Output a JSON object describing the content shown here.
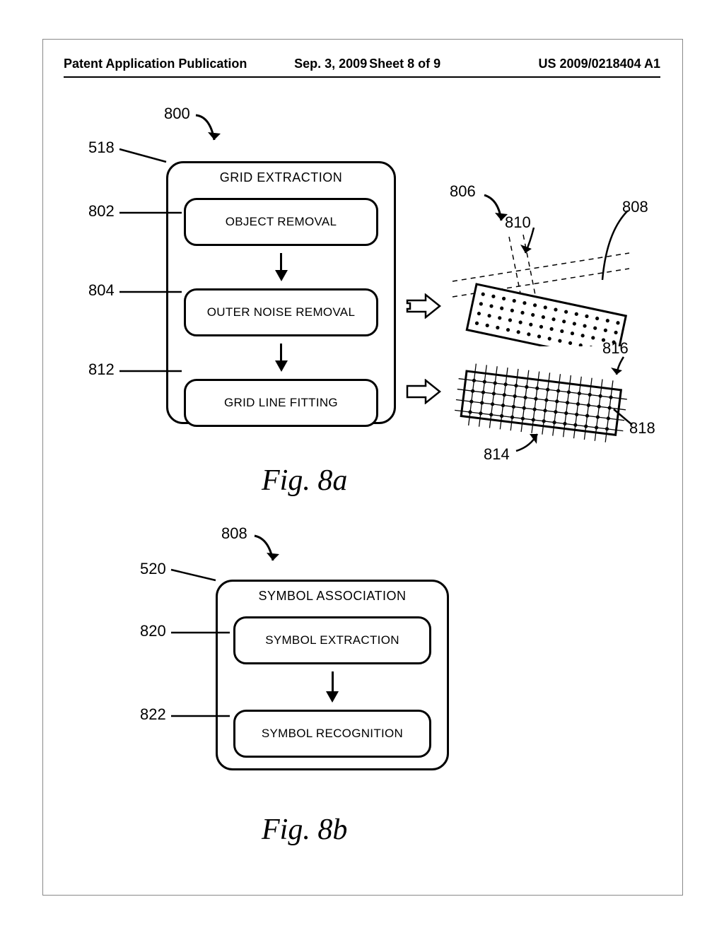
{
  "header": {
    "left": "Patent Application Publication",
    "date": "Sep. 3, 2009",
    "sheet": "Sheet 8 of 9",
    "right": "US 2009/0218404 A1"
  },
  "fig8a": {
    "panel_title": "GRID EXTRACTION",
    "step1": "OBJECT REMOVAL",
    "step2": "OUTER NOISE REMOVAL",
    "step3": "GRID LINE FITTING",
    "label": "Fig. 8a"
  },
  "fig8b": {
    "panel_title": "SYMBOL ASSOCIATION",
    "step1": "SYMBOL EXTRACTION",
    "step2": "SYMBOL RECOGNITION",
    "label": "Fig. 8b"
  },
  "refs": {
    "r800": "800",
    "r518": "518",
    "r802": "802",
    "r804": "804",
    "r812": "812",
    "r806": "806",
    "r808": "808",
    "r810": "810",
    "r816": "816",
    "r814": "814",
    "r818": "818",
    "r808b": "808",
    "r520": "520",
    "r820": "820",
    "r822": "822"
  }
}
